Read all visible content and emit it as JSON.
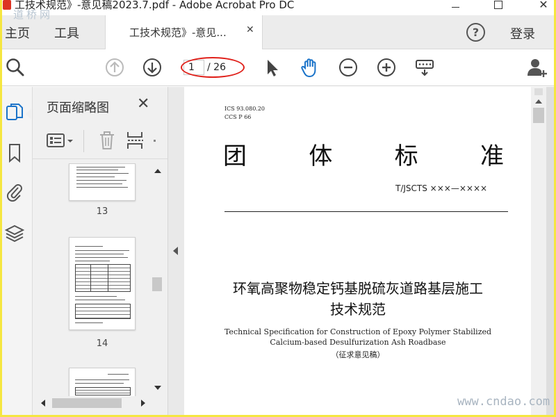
{
  "window": {
    "title": "工技术规范》-意见稿2023.7.pdf - Adobe Acrobat Pro DC"
  },
  "tabbar": {
    "home": "主页",
    "tools": "工具",
    "doc_tab": "工技术规范》-意见...",
    "doc_tab_close": "✕",
    "help": "?",
    "login": "登录"
  },
  "toolbar": {
    "current_page": "1",
    "total_pages": "/ 26"
  },
  "thumbnails": {
    "title": "页面缩略图",
    "close": "✕",
    "pages": [
      {
        "label": "13"
      },
      {
        "label": "14"
      }
    ]
  },
  "document": {
    "ics": "ICS  93.080.20",
    "ccs": "CCS  P  66",
    "heading_chars": [
      "团",
      "体",
      "标",
      "准"
    ],
    "std_number": "T/JSCTS  ×××—××××",
    "title_line1": "环氧高聚物稳定钙基脱硫灰道路基层施工",
    "title_line2": "技术规范",
    "en_line1": "Technical Specification for Construction of Epoxy Polymer Stabilized",
    "en_line2": "Calcium-based Desulfurization Ash Roadbase",
    "en_line3": "（征求意见稿）"
  },
  "watermarks": {
    "top": "道桥网",
    "bottom": "www.cndao.com"
  },
  "colors": {
    "outer_border": "#f5e640",
    "annotation_ellipse": "#e0201a",
    "hand_tool_active": "#1a73c9",
    "sidebar_active_icon": "#1a73c9"
  }
}
